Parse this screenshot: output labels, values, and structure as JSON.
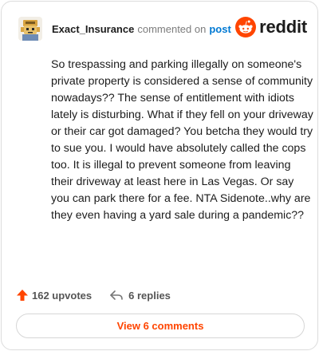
{
  "header": {
    "username": "Exact_Insurance",
    "action": "commented on",
    "target": "post",
    "avatar_icon": "user-avatar-icon",
    "brand_icon": "reddit-alien-icon",
    "brand_text": "reddit"
  },
  "comment": {
    "body": "So trespassing and parking illegally on someone's private property is considered a sense of community nowadays?? The sense of entitlement with idiots lately is disturbing. What if they fell on your driveway or their car got damaged? You betcha they would try to sue you. I would have absolutely called the cops too. It is illegal to prevent someone from leaving their driveway at least here in Las Vegas. Or say you can park there for a fee. NTA Sidenote..why are they even having a yard sale during a pandemic??"
  },
  "footer": {
    "upvotes": "162 upvotes",
    "upvote_icon": "upvote-arrow-icon",
    "replies": "6 replies",
    "reply_icon": "reply-arrow-icon",
    "view_button": "View 6 comments"
  },
  "colors": {
    "accent": "#ff4500",
    "link": "#0079d3",
    "text": "#1c1c1c",
    "muted": "#7c7c7c"
  }
}
